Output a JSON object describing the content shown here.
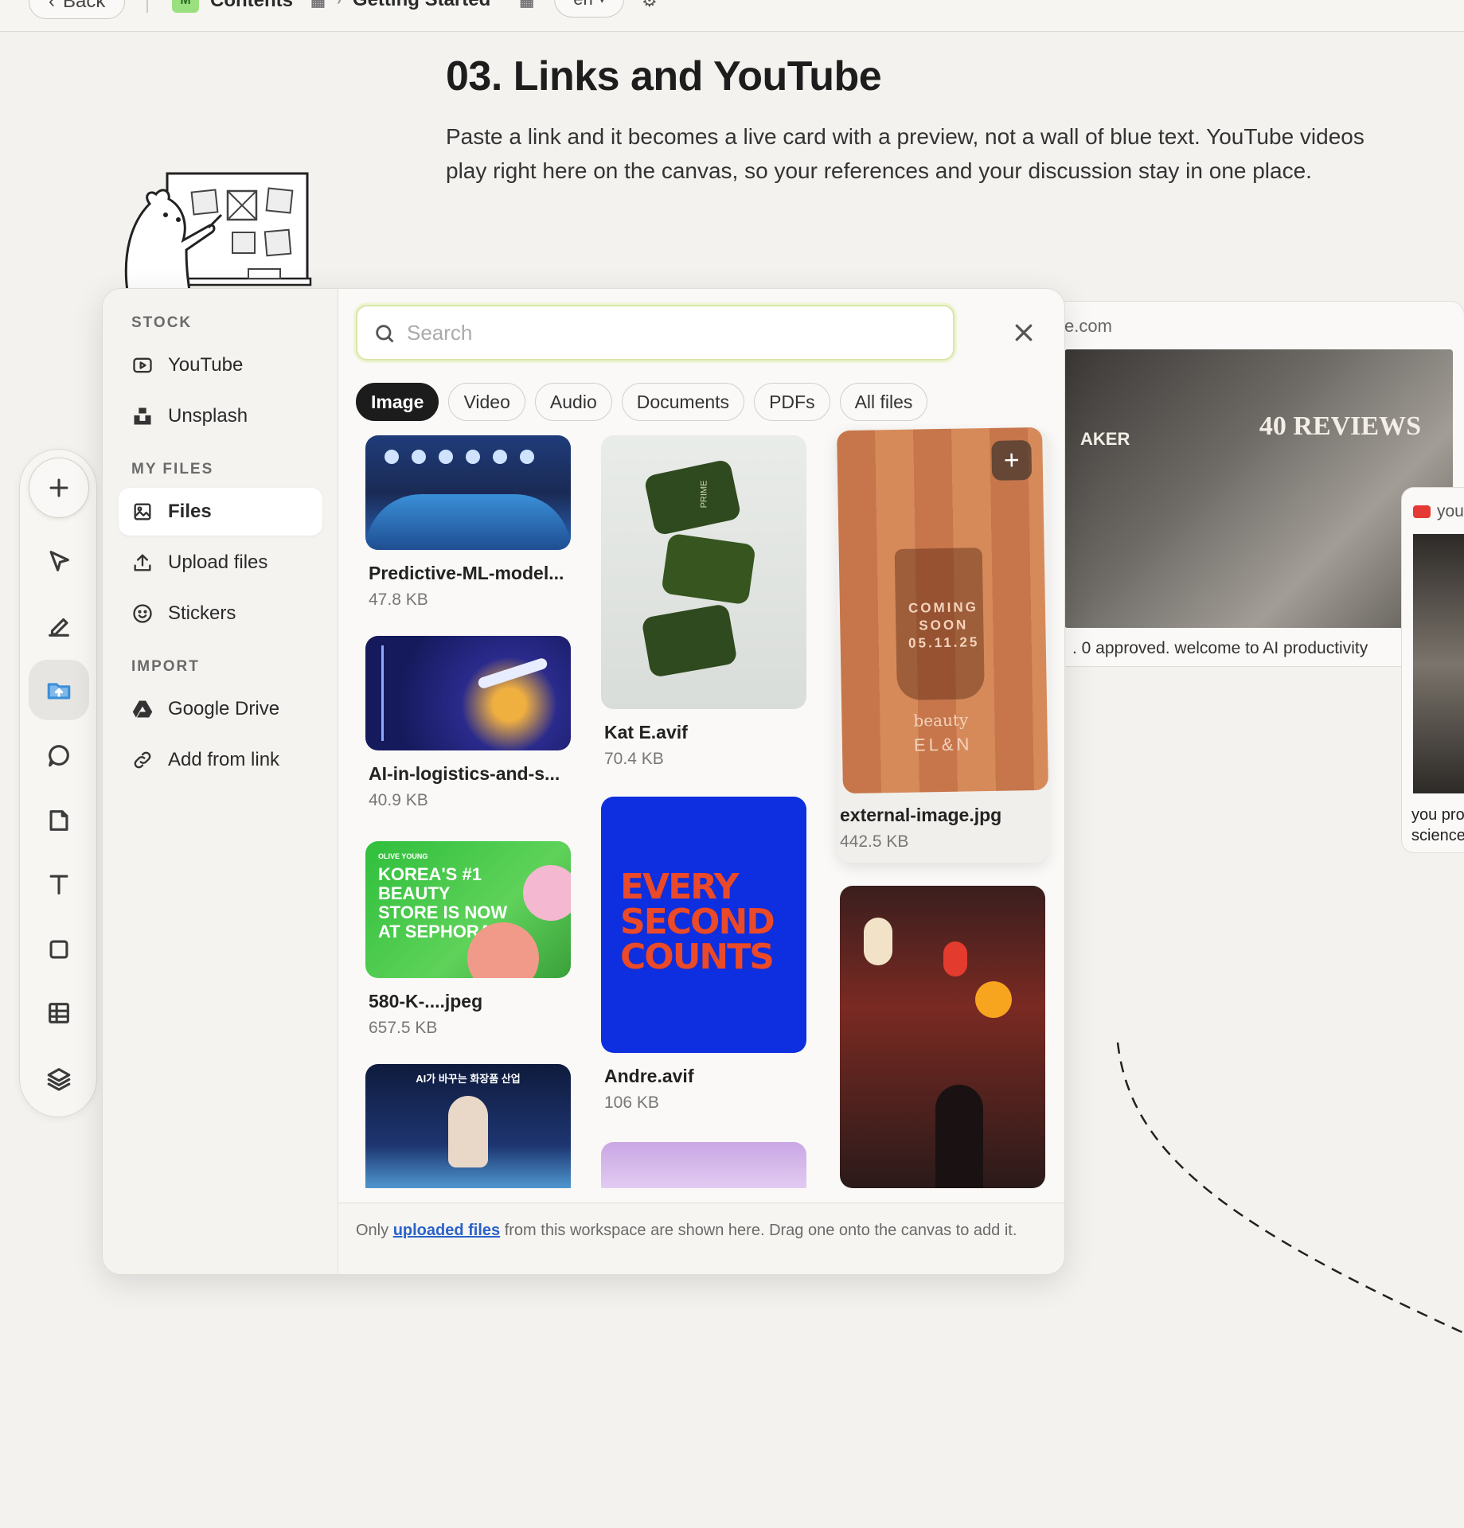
{
  "topbar": {
    "back_label": "Back",
    "workspace_badge": "M",
    "workspace_name": "Contents",
    "page_name": "Getting Started",
    "language": "en"
  },
  "page": {
    "title": "03. Links and YouTube",
    "description": "Paste a link and it becomes a live card with a preview, not a wall of blue text. YouTube videos play right here on the canvas, so your references and your discussion stay in one place."
  },
  "toolbar": {
    "tools": [
      "plus-icon",
      "cursor-icon",
      "pen-icon",
      "files-icon",
      "comment-icon",
      "sticky-note-icon",
      "text-icon",
      "shape-icon",
      "table-icon",
      "layers-icon"
    ],
    "active": "files-icon"
  },
  "picker": {
    "sections": {
      "stock": "STOCK",
      "my_files": "MY FILES",
      "import": "IMPORT"
    },
    "stock_items": [
      "YouTube",
      "Unsplash"
    ],
    "my_files_items": [
      "Files",
      "Upload files",
      "Stickers"
    ],
    "import_items": [
      "Google Drive",
      "Add from link"
    ],
    "search": {
      "placeholder": "Search",
      "value": ""
    },
    "filters": [
      "Image",
      "Video",
      "Audio",
      "Documents",
      "PDFs",
      "All files"
    ],
    "active_filter": "Image",
    "files": [
      {
        "name": "Predictive-ML-model...",
        "size": "47.8 KB"
      },
      {
        "name": "AI-in-logistics-and-s...",
        "size": "40.9 KB"
      },
      {
        "name": "580-K-....jpeg",
        "size": "657.5 KB"
      },
      {
        "name": "Kat E.avif",
        "size": "70.4 KB"
      },
      {
        "name": "Andre.avif",
        "size": "106 KB"
      },
      {
        "name": "external-image.jpg",
        "size": "442.5 KB"
      }
    ],
    "thumb_text": {
      "sephora": "KOREA'S #1 BEAUTY STORE IS NOW AT SEPHORA",
      "sephora_tag": "OLIVE YOUNG",
      "every": "EVERY SECOND COUNTS",
      "coming": "COMING SOON 05.11.25",
      "brand": "EL&N",
      "beauty": "beauty",
      "prime": "PRIME",
      "korean": "AI가 바꾸는 화장품 산업"
    },
    "footer": {
      "pre": "Only ",
      "link": "uploaded files",
      "post": " from this workspace are shown here. Drag one onto the canvas to add it."
    }
  },
  "canvas": {
    "link_card": {
      "url": "e.com",
      "caption": ". 0 approved. welcome to AI productivity",
      "overlay_reviews": "40 REVIEWS",
      "overlay_aker": "AKER"
    },
    "youtube_card": {
      "source": "you",
      "title": "you pro science"
    }
  },
  "colors": {
    "accent_blue": "#3c8fd8",
    "link_blue": "#2a62c9",
    "search_focus": "#d8e6a9"
  }
}
